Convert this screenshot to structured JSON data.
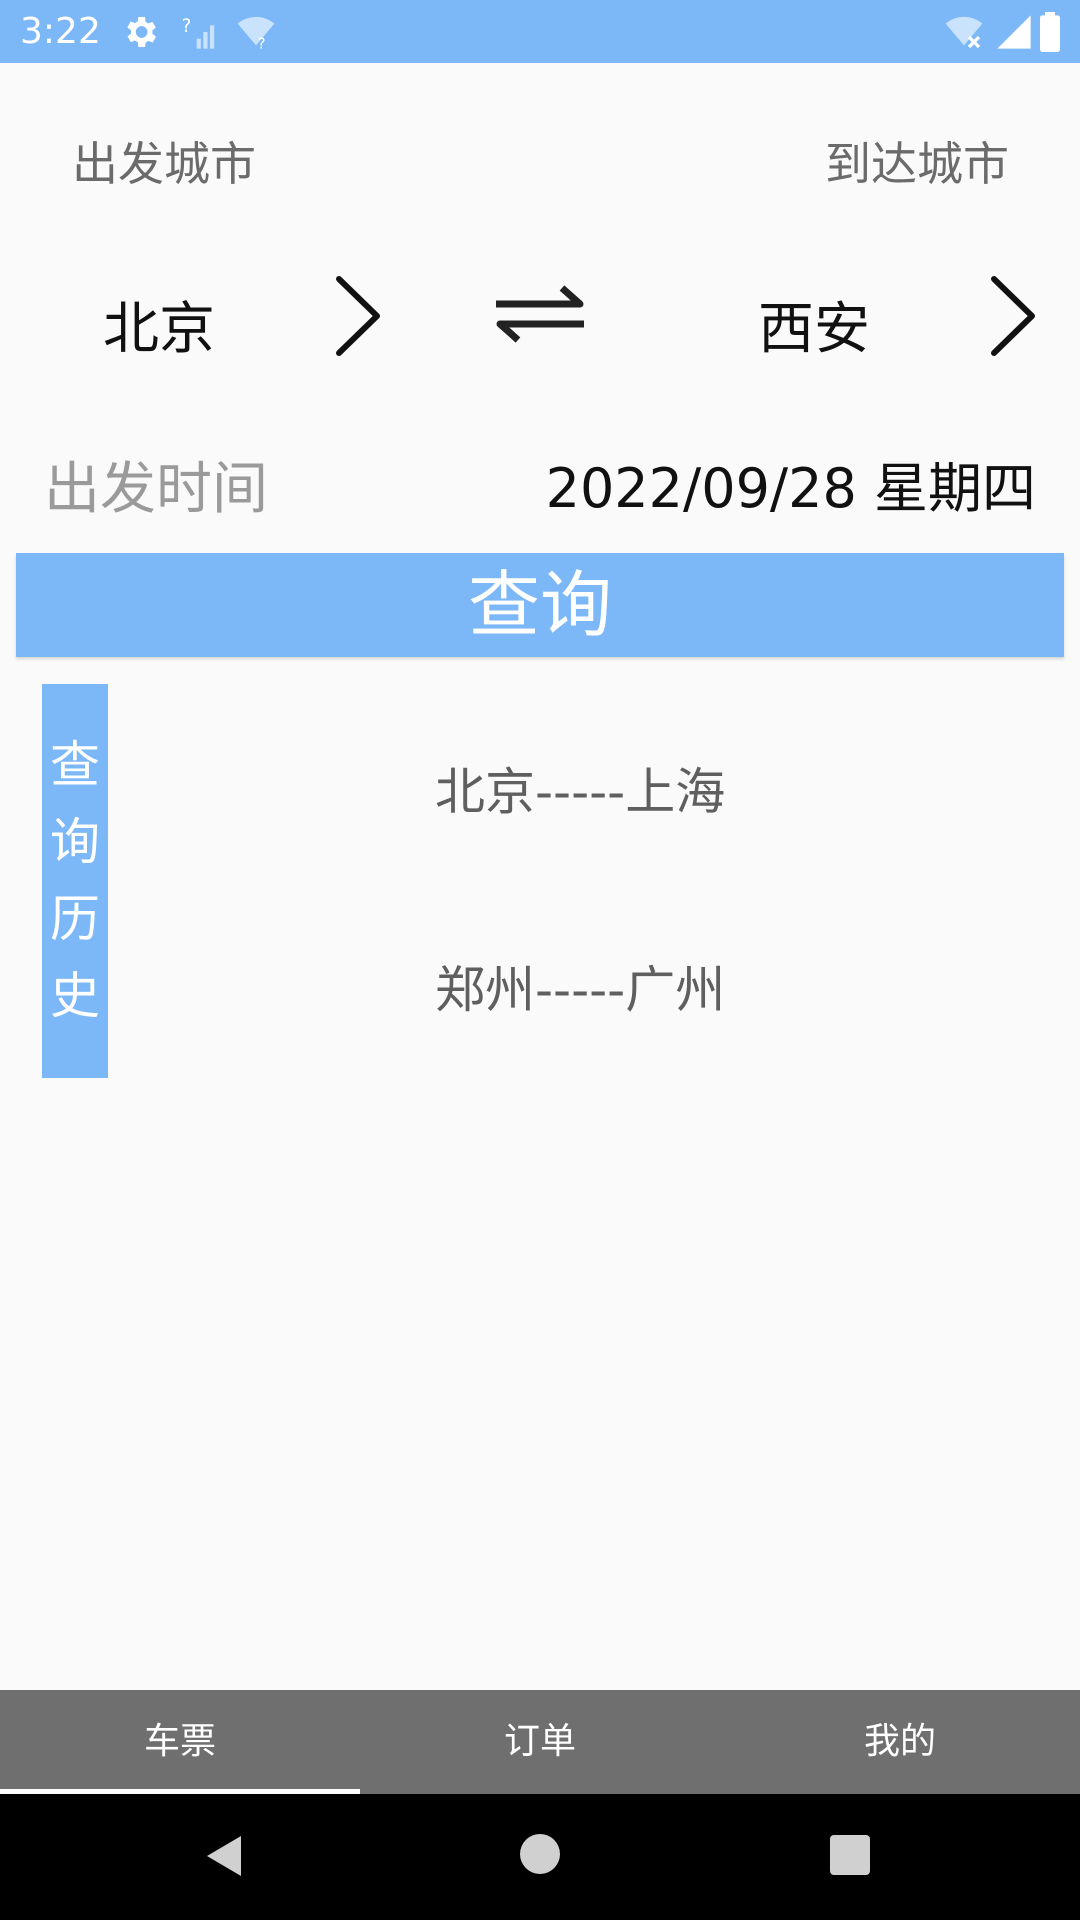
{
  "status_bar": {
    "time": "3:22",
    "icons": [
      "gear-icon",
      "signal-unknown-icon",
      "wifi-unknown-icon",
      "wifi-off-icon",
      "cell-signal-icon",
      "battery-icon"
    ]
  },
  "route": {
    "depart_city_label": "出发城市",
    "arrive_city_label": "到达城市",
    "from_city": "北京",
    "to_city": "西安"
  },
  "time": {
    "label": "出发时间",
    "date": "2022/09/28 星期四"
  },
  "search": {
    "label": "查询"
  },
  "history": {
    "tag_chars": [
      "查",
      "询",
      "历",
      "史"
    ],
    "items": [
      "北京-----上海",
      "郑州-----广州"
    ]
  },
  "tabs": [
    {
      "label": "车票",
      "active": true
    },
    {
      "label": "订单",
      "active": false
    },
    {
      "label": "我的",
      "active": false
    }
  ],
  "colors": {
    "accent": "#7cb8f7",
    "tabbar": "#6f6f6f"
  }
}
